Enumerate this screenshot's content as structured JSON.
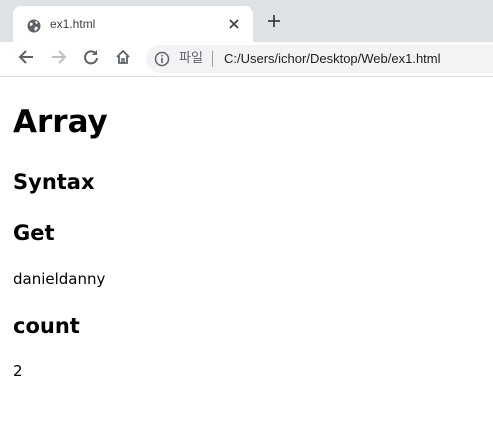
{
  "browser": {
    "tab": {
      "title": "ex1.html",
      "favicon": "globe-icon",
      "close_icon": "close-icon"
    },
    "new_tab_icon": "plus-icon",
    "toolbar": {
      "back_icon": "arrow-left-icon",
      "forward_icon": "arrow-right-icon",
      "reload_icon": "reload-icon",
      "home_icon": "home-icon",
      "info_icon": "info-icon",
      "origin_chip": "파일",
      "url": "C:/Users/ichor/Desktop/Web/ex1.html"
    }
  },
  "page": {
    "heading": "Array",
    "sections": [
      {
        "title": "Syntax"
      },
      {
        "title": "Get",
        "text": "danieldanny"
      },
      {
        "title": "count",
        "text": "2"
      }
    ]
  },
  "colors": {
    "tab_strip": "#dee1e6",
    "omnibox": "#f1f3f4",
    "icon": "#5f6368"
  }
}
